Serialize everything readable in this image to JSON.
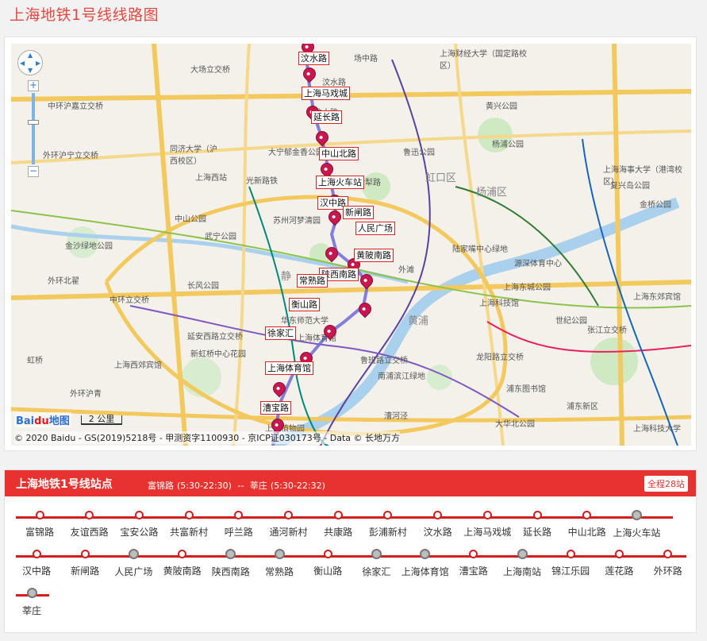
{
  "page": {
    "title": "上海地铁1号线线路图"
  },
  "map": {
    "station_tags": [
      "汶水路",
      "上海马戏城",
      "延长路",
      "中山北路",
      "上海火车站",
      "汉中路",
      "新闸路",
      "人民广场",
      "黄陂南路",
      "陕西南路",
      "常熟路",
      "衡山路",
      "徐家汇",
      "上海体育馆",
      "漕宝路"
    ],
    "place_labels": [
      "大场立交桥",
      "汶水路",
      "场中路",
      "沪太路",
      "上海财经大学（国定路校区）",
      "复兴岛公园",
      "黄兴公园",
      "杨浦公园",
      "虹口区",
      "杨浦区",
      "上海海事大学（港湾校区）",
      "金桥公园",
      "中环沪嘉立交桥",
      "外环沪宁立交桥",
      "同济大学（沪西校区）",
      "大宁郁金香公园",
      "鲁迅公园",
      "上海西站",
      "光新路铁",
      "苏州河梦清园",
      "中山公园",
      "武宁公园",
      "长风公园",
      "静",
      "外滩",
      "上海科技馆",
      "世纪公园",
      "张江立交桥",
      "上海东郊宾馆",
      "浦东新区",
      "延安西路立交桥",
      "新虹桥中心花园",
      "华东师范大学",
      "上海体育馆",
      "上海西郊宾馆",
      "外环沪青",
      "鲁班路立交桥",
      "南浦滨江绿地",
      "上海植物园",
      "龙阳路立交桥",
      "浦东图书馆",
      "金沙绿地公园",
      "陆家嘴中心绿地",
      "源深体育中心",
      "黄浦",
      "上海东城公园",
      "中环立交桥",
      "虹桥",
      "漕河泾",
      "大华北公园",
      "上海科技大学",
      "外环北翟",
      "伊犁路"
    ],
    "attribution": {
      "logo_text": "Bai",
      "logo_red": "du",
      "logo_suffix": "地图",
      "scale": "2 公里",
      "copyright": "© 2020 Baidu - GS(2019)5218号 - 甲测资字1100930 - 京ICP证030173号 - Data © 长地万方"
    }
  },
  "stations_panel": {
    "title": "上海地铁1号线站点",
    "start": {
      "name": "富锦路",
      "hours": "(5:30-22:30)"
    },
    "separator": "--",
    "end": {
      "name": "莘庄",
      "hours": "(5:30-22:32)"
    },
    "total": "全程28站",
    "rows": [
      [
        {
          "name": "富锦路",
          "transfer": false
        },
        {
          "name": "友谊西路",
          "transfer": false
        },
        {
          "name": "宝安公路",
          "transfer": false
        },
        {
          "name": "共富新村",
          "transfer": false
        },
        {
          "name": "呼兰路",
          "transfer": false
        },
        {
          "name": "通河新村",
          "transfer": false
        },
        {
          "name": "共康路",
          "transfer": false
        },
        {
          "name": "彭浦新村",
          "transfer": false
        },
        {
          "name": "汶水路",
          "transfer": false
        },
        {
          "name": "上海马戏城",
          "transfer": false
        },
        {
          "name": "延长路",
          "transfer": false
        },
        {
          "name": "中山北路",
          "transfer": false
        },
        {
          "name": "上海火车站",
          "transfer": true
        }
      ],
      [
        {
          "name": "汉中路",
          "transfer": false
        },
        {
          "name": "新闸路",
          "transfer": false
        },
        {
          "name": "人民广场",
          "transfer": true
        },
        {
          "name": "黄陂南路",
          "transfer": false
        },
        {
          "name": "陕西南路",
          "transfer": true
        },
        {
          "name": "常熟路",
          "transfer": true
        },
        {
          "name": "衡山路",
          "transfer": false
        },
        {
          "name": "徐家汇",
          "transfer": true
        },
        {
          "name": "上海体育馆",
          "transfer": true
        },
        {
          "name": "漕宝路",
          "transfer": false
        },
        {
          "name": "上海南站",
          "transfer": true
        },
        {
          "name": "锦江乐园",
          "transfer": false
        },
        {
          "name": "莲花路",
          "transfer": false
        },
        {
          "name": "外环路",
          "transfer": false
        }
      ],
      [
        {
          "name": "莘庄",
          "transfer": true
        }
      ]
    ]
  }
}
